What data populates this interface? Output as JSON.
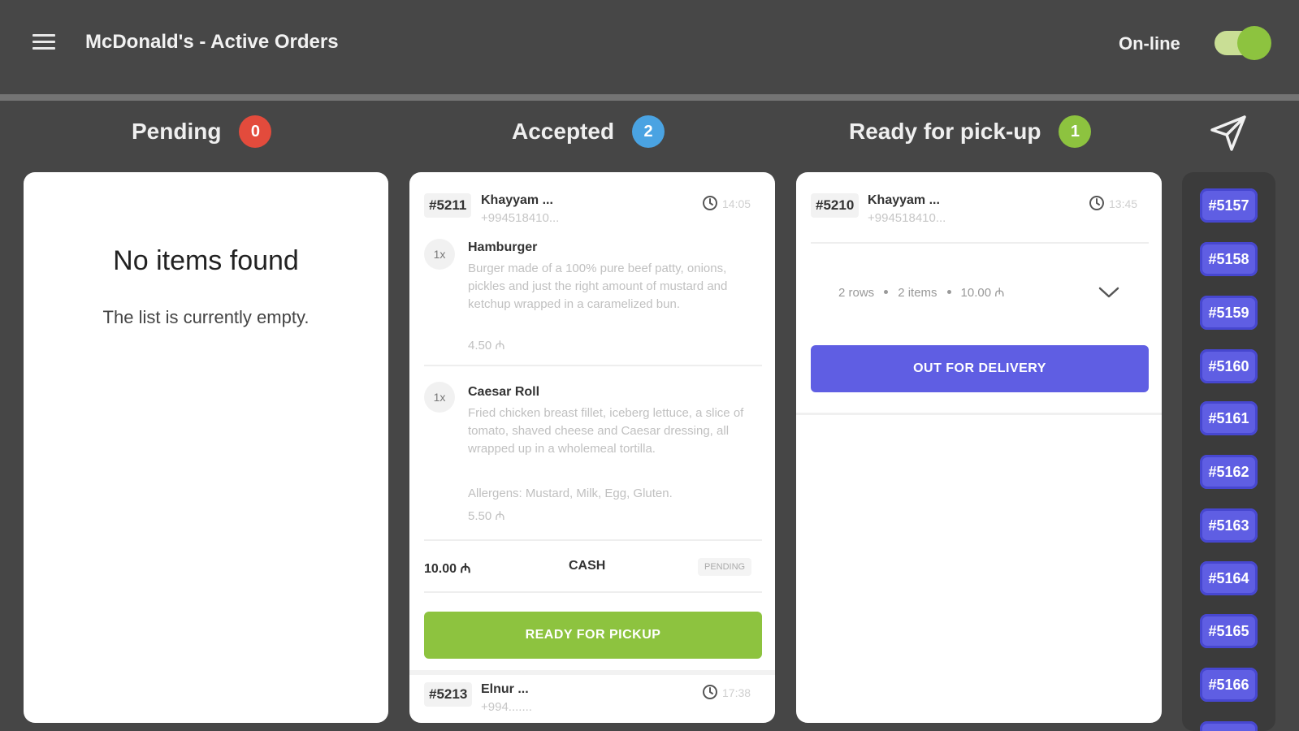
{
  "header": {
    "title": "McDonald's - Active Orders",
    "online_label": "On-line",
    "online_enabled": true
  },
  "columns": {
    "pending": {
      "title": "Pending",
      "count": "0",
      "badge_color": "#e34b3c"
    },
    "accepted": {
      "title": "Accepted",
      "count": "2",
      "badge_color": "#4aa3e2"
    },
    "ready": {
      "title": "Ready for pick-up",
      "count": "1",
      "badge_color": "#8dc33f"
    }
  },
  "pending_panel": {
    "empty_title": "No items found",
    "empty_subtitle": "The list is currently empty."
  },
  "accepted_orders": [
    {
      "id": "#5211",
      "customer": "Khayyam ...",
      "phone": "+994518410...",
      "time": "14:05",
      "items": [
        {
          "qty": "1x",
          "name": "Hamburger",
          "description": "Burger made of a 100% pure beef patty, onions, pickles and just the right amount of mustard and ketchup wrapped in a caramelized bun.",
          "price": "4.50 ₼"
        },
        {
          "qty": "1x",
          "name": "Caesar Roll",
          "description": "Fried chicken breast fillet, iceberg lettuce, a slice of tomato, shaved cheese and Caesar dressing, all wrapped up in a wholemeal tortilla.",
          "allergens": "Allergens: Mustard, Milk, Egg, Gluten.",
          "price": "5.50 ₼"
        }
      ],
      "total": "10.00 ₼",
      "payment": "CASH",
      "status": "PENDING",
      "action_label": "READY FOR PICKUP"
    },
    {
      "id": "#5213",
      "customer": "Elnur ...",
      "phone": "+994.......",
      "time": "17:38"
    }
  ],
  "ready_orders": [
    {
      "id": "#5210",
      "customer": "Khayyam ...",
      "phone": "+994518410...",
      "time": "13:45",
      "summary_rows": "2 rows",
      "summary_items": "2 items",
      "summary_total": "10.00 ₼",
      "action_label": "OUT FOR DELIVERY"
    }
  ],
  "sidebar_chips": [
    "#5157",
    "#5158",
    "#5159",
    "#5160",
    "#5161",
    "#5162",
    "#5163",
    "#5164",
    "#5165",
    "#5166"
  ],
  "colors": {
    "accent_green": "#8dc33f",
    "accent_purple": "#5f5ee3",
    "background": "#464646"
  }
}
